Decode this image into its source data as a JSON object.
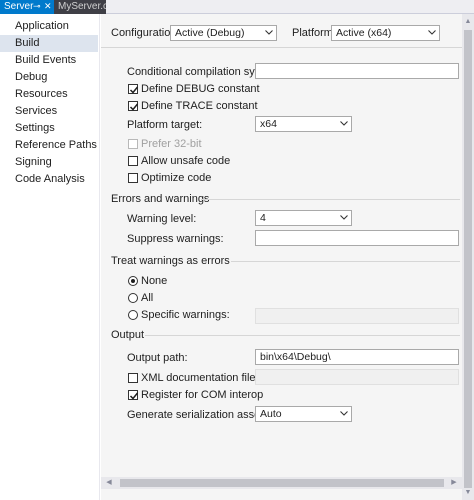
{
  "tabs": [
    {
      "label": "Server",
      "pin": "⊸",
      "close": "✕"
    },
    {
      "label": "MyServer.cs"
    }
  ],
  "sidebar": {
    "items": [
      {
        "label": "Application"
      },
      {
        "label": "Build"
      },
      {
        "label": "Build Events"
      },
      {
        "label": "Debug"
      },
      {
        "label": "Resources"
      },
      {
        "label": "Services"
      },
      {
        "label": "Settings"
      },
      {
        "label": "Reference Paths"
      },
      {
        "label": "Signing"
      },
      {
        "label": "Code Analysis"
      }
    ],
    "selected": "Build"
  },
  "header": {
    "configuration_label": "Configuration:",
    "configuration_value": "Active (Debug)",
    "platform_label": "Platform:",
    "platform_value": "Active (x64)"
  },
  "general": {
    "conditional_symbols_label": "Conditional compilation symbols:",
    "conditional_symbols_value": "",
    "define_debug_label": "Define DEBUG constant",
    "define_debug_checked": true,
    "define_trace_label": "Define TRACE constant",
    "define_trace_checked": true,
    "platform_target_label": "Platform target:",
    "platform_target_value": "x64",
    "prefer32_label": "Prefer 32-bit",
    "prefer32_checked": false,
    "unsafe_label": "Allow unsafe code",
    "unsafe_checked": false,
    "optimize_label": "Optimize code",
    "optimize_checked": false
  },
  "errors": {
    "section_title": "Errors and warnings",
    "warning_level_label": "Warning level:",
    "warning_level_value": "4",
    "suppress_label": "Suppress warnings:",
    "suppress_value": ""
  },
  "treat": {
    "section_title": "Treat warnings as errors",
    "none_label": "None",
    "all_label": "All",
    "specific_label": "Specific warnings:",
    "specific_value": "",
    "selected": "None"
  },
  "output": {
    "section_title": "Output",
    "path_label": "Output path:",
    "path_value": "bin\\x64\\Debug\\",
    "xmldoc_label": "XML documentation file:",
    "xmldoc_checked": false,
    "xmldoc_value": "",
    "com_label": "Register for COM interop",
    "com_checked": true,
    "serialization_label": "Generate serialization assembly:",
    "serialization_value": "Auto"
  },
  "colors": {
    "active_tab": "#007acc",
    "inactive_tab": "#3f3f46",
    "selected_nav": "#dde4ee",
    "content_bg": "#f5f5f5"
  },
  "icons": {
    "dropdown": "chevron-down-icon",
    "check": "checkmark-icon",
    "pin": "pin-icon",
    "close": "close-icon"
  }
}
